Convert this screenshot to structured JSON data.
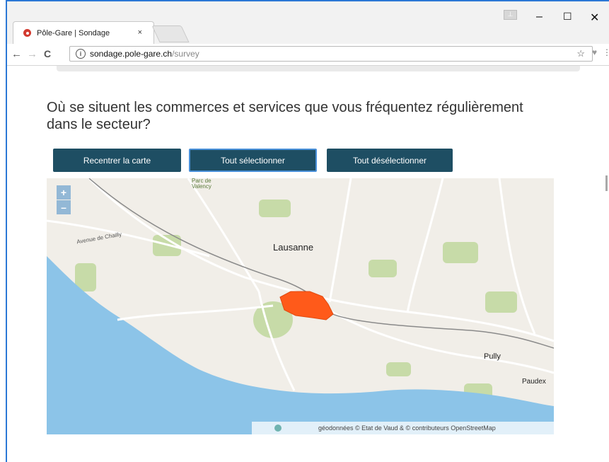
{
  "browser": {
    "tab_title": "Pôle-Gare | Sondage",
    "tab_close": "×",
    "url_host": "sondage.pole-gare.ch",
    "url_path": "/survey",
    "back_glyph": "←",
    "forward_glyph": "→",
    "reload_glyph": "C",
    "info_glyph": "i",
    "star_glyph": "☆",
    "minimize_glyph": "–",
    "maximize_glyph": "☐",
    "close_glyph": "✕"
  },
  "page": {
    "question": "Où se situent les commerces et services que vous fréquentez régulièrement dans le secteur?",
    "buttons": {
      "recenter": "Recentrer la carte",
      "select_all": "Tout sélectionner",
      "deselect_all": "Tout désélectionner"
    }
  },
  "map": {
    "zoom_in": "+",
    "zoom_out": "–",
    "labels": {
      "lausanne": "Lausanne",
      "pully": "Pully",
      "paudex": "Paudex",
      "parc": "Parc de Valency",
      "avenue": "Avenue de Chailly"
    },
    "attribution": "géodonnées © Etat de Vaud & © contributeurs OpenStreetMap",
    "colors": {
      "lake": "#8cc4e8",
      "land": "#f1eee8",
      "selection": "#ff5a1a",
      "park": "#c7dba8"
    }
  }
}
